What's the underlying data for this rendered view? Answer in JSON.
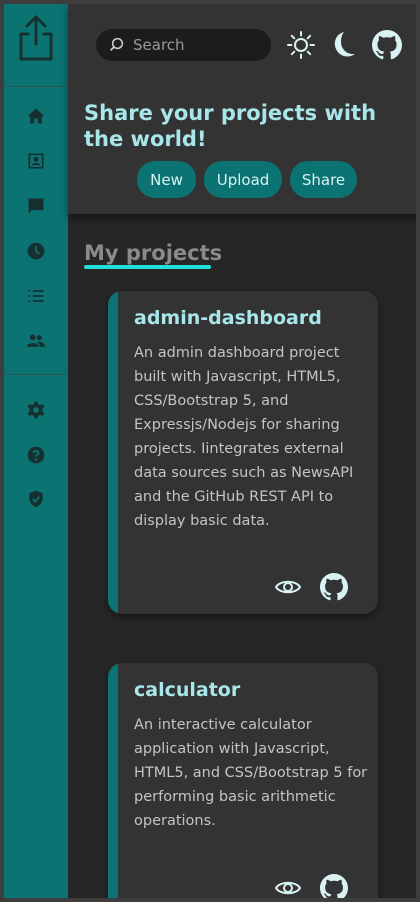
{
  "header": {
    "search_placeholder": "Search",
    "tagline": "Share your projects with the world!",
    "buttons": {
      "new": "New",
      "upload": "Upload",
      "share": "Share"
    }
  },
  "main": {
    "section_title": "My projects",
    "projects": [
      {
        "title": "admin-dashboard",
        "description": "An admin dashboard project built with Javascript, HTML5, CSS/Bootstrap 5, and Expressjs/Nodejs for sharing projects. Iintegrates external data sources such as NewsAPI and the GitHub REST API to display basic data."
      },
      {
        "title": "calculator",
        "description": "An interactive calculator application with Javascript, HTML5, and CSS/Bootstrap 5 for performing basic arithmetic operations."
      }
    ]
  },
  "icons": {
    "sidebar": [
      "share-icon",
      "home-icon",
      "profile-icon",
      "messages-icon",
      "history-icon",
      "list-icon",
      "users-icon",
      "settings-icon",
      "help-icon",
      "security-icon"
    ],
    "header": [
      "search-icon",
      "sun-icon",
      "moon-icon",
      "github-icon"
    ],
    "card": [
      "eye-icon",
      "github-icon"
    ]
  },
  "colors": {
    "accent": "#0c7373",
    "highlight": "#25e0d8",
    "title_text": "#a8e6ea",
    "background": "#262626",
    "panel": "#333333"
  }
}
